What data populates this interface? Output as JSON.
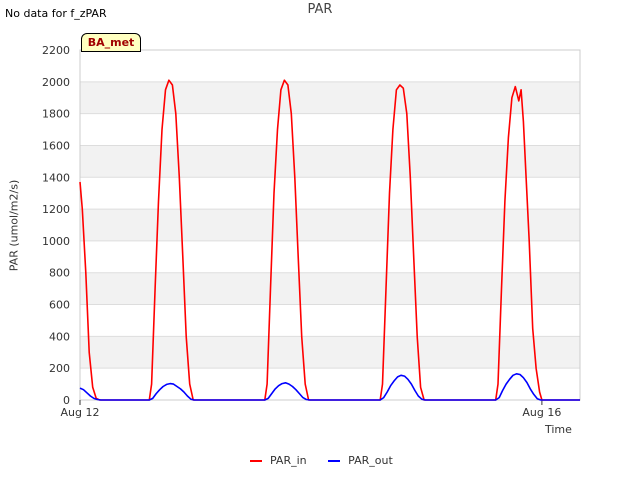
{
  "header": {
    "nodata_text": "No data for f_zPAR",
    "badge": "BA_met"
  },
  "chart_data": {
    "type": "line",
    "title": "PAR",
    "xlabel": "Time",
    "ylabel": "PAR (umol/m2/s)",
    "ylim": [
      0,
      2200
    ],
    "yticks": [
      0,
      200,
      400,
      600,
      800,
      1000,
      1200,
      1400,
      1600,
      1800,
      2000,
      2200
    ],
    "xlim_days": [
      0,
      4.33
    ],
    "xticks": [
      {
        "label": "Aug 12",
        "day": 0
      },
      {
        "label": "Aug 16",
        "day": 4
      }
    ],
    "grid": true,
    "legend": "bottom",
    "series": [
      {
        "name": "PAR_in",
        "color": "#ff0000",
        "x": [
          0.0,
          0.02,
          0.05,
          0.08,
          0.11,
          0.14,
          0.17,
          0.2,
          0.25,
          0.3,
          0.35,
          0.4,
          0.5,
          0.6,
          0.62,
          0.65,
          0.68,
          0.71,
          0.74,
          0.77,
          0.8,
          0.83,
          0.86,
          0.89,
          0.92,
          0.95,
          0.98,
          1.01,
          1.04,
          1.06,
          1.1,
          1.2,
          1.3,
          1.4,
          1.5,
          1.6,
          1.62,
          1.65,
          1.68,
          1.71,
          1.74,
          1.77,
          1.8,
          1.83,
          1.86,
          1.89,
          1.92,
          1.95,
          1.98,
          2.01,
          2.04,
          2.06,
          2.1,
          2.2,
          2.3,
          2.4,
          2.5,
          2.6,
          2.62,
          2.65,
          2.68,
          2.71,
          2.74,
          2.77,
          2.8,
          2.83,
          2.86,
          2.89,
          2.92,
          2.95,
          2.98,
          3.01,
          3.04,
          3.06,
          3.1,
          3.2,
          3.3,
          3.4,
          3.5,
          3.6,
          3.62,
          3.65,
          3.68,
          3.71,
          3.74,
          3.77,
          3.8,
          3.82,
          3.84,
          3.86,
          3.89,
          3.92,
          3.95,
          3.98,
          4.0,
          4.02,
          4.04,
          4.06,
          4.1,
          4.2,
          4.33
        ],
        "y": [
          1370,
          1200,
          800,
          300,
          80,
          10,
          0,
          0,
          0,
          0,
          0,
          0,
          0,
          0,
          100,
          700,
          1250,
          1700,
          1950,
          2010,
          1980,
          1800,
          1400,
          900,
          400,
          100,
          0,
          0,
          0,
          0,
          0,
          0,
          0,
          0,
          0,
          0,
          100,
          700,
          1300,
          1700,
          1950,
          2010,
          1980,
          1800,
          1400,
          900,
          400,
          100,
          0,
          0,
          0,
          0,
          0,
          0,
          0,
          0,
          0,
          0,
          100,
          700,
          1300,
          1700,
          1950,
          1980,
          1960,
          1800,
          1400,
          900,
          400,
          80,
          0,
          0,
          0,
          0,
          0,
          0,
          0,
          0,
          0,
          0,
          100,
          700,
          1250,
          1650,
          1900,
          1970,
          1880,
          1950,
          1750,
          1450,
          1000,
          450,
          200,
          50,
          0,
          0,
          0,
          0,
          0,
          0,
          0
        ]
      },
      {
        "name": "PAR_out",
        "color": "#0000ff",
        "x": [
          0.0,
          0.03,
          0.06,
          0.09,
          0.12,
          0.15,
          0.18,
          0.25,
          0.4,
          0.6,
          0.63,
          0.66,
          0.69,
          0.72,
          0.75,
          0.78,
          0.81,
          0.84,
          0.87,
          0.9,
          0.93,
          0.96,
          0.99,
          1.02,
          1.1,
          1.3,
          1.6,
          1.63,
          1.66,
          1.69,
          1.72,
          1.75,
          1.78,
          1.81,
          1.84,
          1.87,
          1.9,
          1.93,
          1.96,
          1.99,
          2.02,
          2.1,
          2.3,
          2.6,
          2.63,
          2.66,
          2.69,
          2.72,
          2.75,
          2.78,
          2.81,
          2.84,
          2.87,
          2.9,
          2.93,
          2.96,
          2.99,
          3.02,
          3.1,
          3.3,
          3.6,
          3.63,
          3.66,
          3.69,
          3.72,
          3.75,
          3.78,
          3.81,
          3.84,
          3.87,
          3.9,
          3.93,
          3.96,
          3.99,
          4.02,
          4.1,
          4.33
        ],
        "y": [
          75,
          65,
          45,
          25,
          10,
          3,
          0,
          0,
          0,
          0,
          10,
          40,
          65,
          85,
          98,
          103,
          100,
          85,
          70,
          50,
          25,
          5,
          0,
          0,
          0,
          0,
          0,
          10,
          40,
          70,
          90,
          103,
          108,
          100,
          85,
          65,
          40,
          15,
          3,
          0,
          0,
          0,
          0,
          0,
          15,
          50,
          90,
          120,
          145,
          155,
          150,
          130,
          100,
          60,
          25,
          5,
          0,
          0,
          0,
          0,
          0,
          15,
          60,
          100,
          130,
          155,
          165,
          160,
          140,
          110,
          70,
          35,
          8,
          0,
          0,
          0,
          0
        ]
      }
    ]
  }
}
